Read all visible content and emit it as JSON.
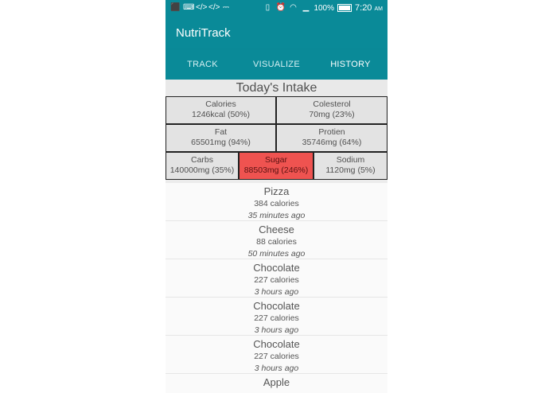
{
  "status_bar": {
    "battery": "100%",
    "time": "7:20",
    "ampm": "AM",
    "icons": [
      "notification-add-icon",
      "keyboard-icon",
      "code-icon",
      "code-icon",
      "usb-icon",
      "vibrate-icon",
      "alarm-icon",
      "wifi-icon",
      "signal-icon",
      "battery-icon"
    ]
  },
  "app": {
    "title": "NutriTrack",
    "accent_color": "#0a8a98"
  },
  "tabs": [
    {
      "label": "TRACK"
    },
    {
      "label": "VISUALIZE"
    },
    {
      "label": "HISTORY"
    }
  ],
  "today": {
    "title": "Today's Intake",
    "nutrients": [
      {
        "name": "Calories",
        "value": "1246kcal (50%)"
      },
      {
        "name": "Colesterol",
        "value": "70mg (23%)"
      },
      {
        "name": "Fat",
        "value": "65501mg (94%)"
      },
      {
        "name": "Protien",
        "value": "35746mg (64%)"
      },
      {
        "name": "Carbs",
        "value": "140000mg (35%)"
      },
      {
        "name": "Sugar",
        "value": "88503mg (246%)",
        "alert_color": "#ef5350"
      },
      {
        "name": "Sodium",
        "value": "1120mg (5%)"
      }
    ]
  },
  "history": [
    {
      "name": "Pizza",
      "calories": "384 calories",
      "time": "35 minutes ago"
    },
    {
      "name": "Cheese",
      "calories": "88 calories",
      "time": "50 minutes ago"
    },
    {
      "name": "Chocolate",
      "calories": "227 calories",
      "time": "3 hours ago"
    },
    {
      "name": "Chocolate",
      "calories": "227 calories",
      "time": "3 hours ago"
    },
    {
      "name": "Chocolate",
      "calories": "227 calories",
      "time": "3 hours ago"
    },
    {
      "name": "Apple",
      "calories": "",
      "time": ""
    }
  ]
}
